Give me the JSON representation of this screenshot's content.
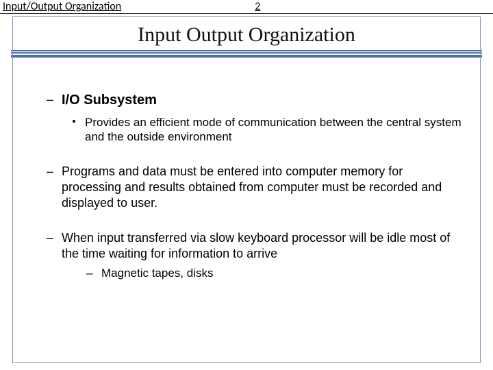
{
  "header": {
    "topic": "Input/Output Organization",
    "page_number": "2"
  },
  "title": "Input Output Organization",
  "content": {
    "items": [
      {
        "dash": "–",
        "heading": "I/O Subsystem",
        "sub_bullet": {
          "text": "Provides an efficient mode of communication between the central system and the outside environment"
        }
      },
      {
        "dash": "–",
        "text": "Programs and data must be entered into computer memory for processing and results obtained from computer must be recorded and displayed to user."
      },
      {
        "dash": "–",
        "text": "When input transferred via slow keyboard processor will be idle most of the time waiting for information to arrive",
        "sub_dash": {
          "dash": "–",
          "text": "Magnetic tapes, disks"
        }
      }
    ]
  }
}
